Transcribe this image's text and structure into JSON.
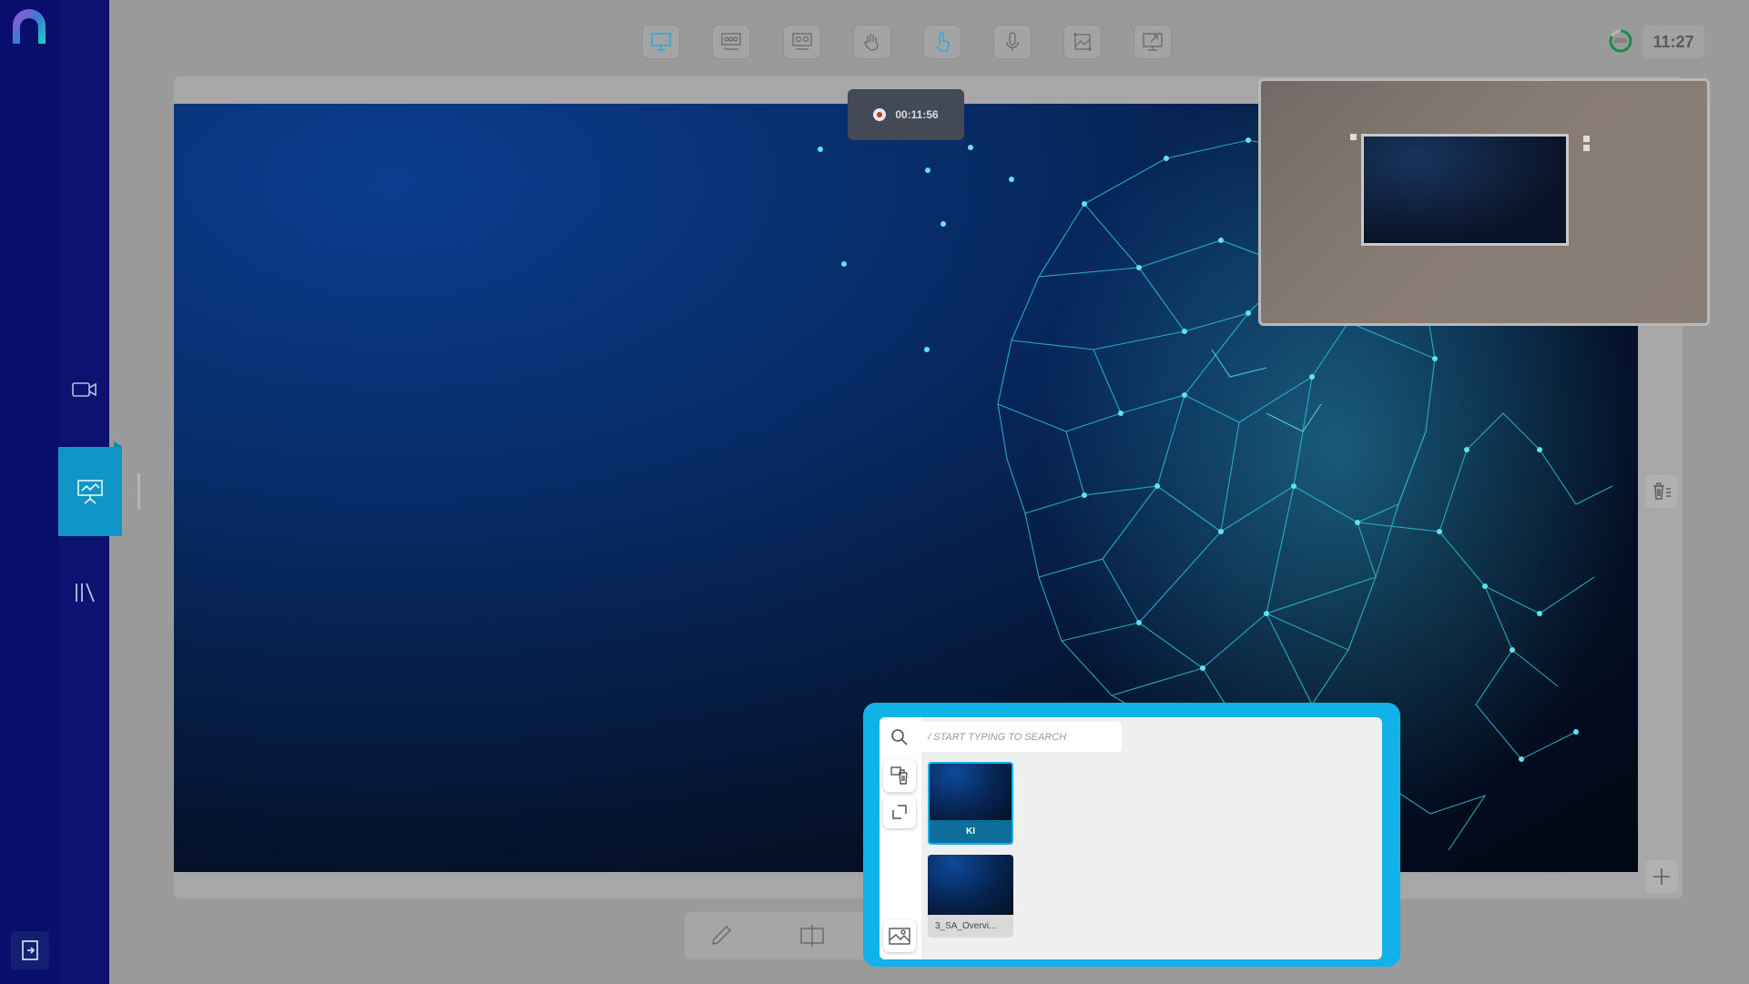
{
  "app": {
    "logo_icon": "app-logo-arch",
    "accent_color": "#10b2e8",
    "rail_color": "#0a0f6e"
  },
  "sidebar": {
    "items": [
      {
        "name": "video",
        "icon": "video-camera-icon",
        "active": false
      },
      {
        "name": "presentation",
        "icon": "presentation-board-icon",
        "active": true
      },
      {
        "name": "library",
        "icon": "library-books-icon",
        "active": false
      }
    ],
    "logout_icon": "logout-icon"
  },
  "toolbar": {
    "tools": [
      {
        "icon": "present-screen-icon"
      },
      {
        "icon": "audience-view-icon"
      },
      {
        "icon": "group-view-icon"
      },
      {
        "icon": "raise-hand-icon"
      },
      {
        "icon": "pointer-touch-icon"
      },
      {
        "icon": "microphone-icon"
      },
      {
        "icon": "image-crop-icon"
      },
      {
        "icon": "share-screen-icon"
      }
    ],
    "battery_label": "83%",
    "clock": "11:27"
  },
  "recording": {
    "time": "00:11:56",
    "status_color": "#c0392b"
  },
  "side_actions": {
    "delete_icon": "trash-list-icon",
    "add_icon": "plus-icon"
  },
  "picker": {
    "search_placeholder": "/ START TYPING TO SEARCH",
    "search_value": "",
    "slides": [
      {
        "label": "KI",
        "selected": true
      },
      {
        "label": "3_SA_Overvi...",
        "selected": false
      }
    ],
    "actions": [
      "search-icon",
      "copy-delete-icon",
      "expand-icon",
      "image-gallery-icon"
    ]
  }
}
